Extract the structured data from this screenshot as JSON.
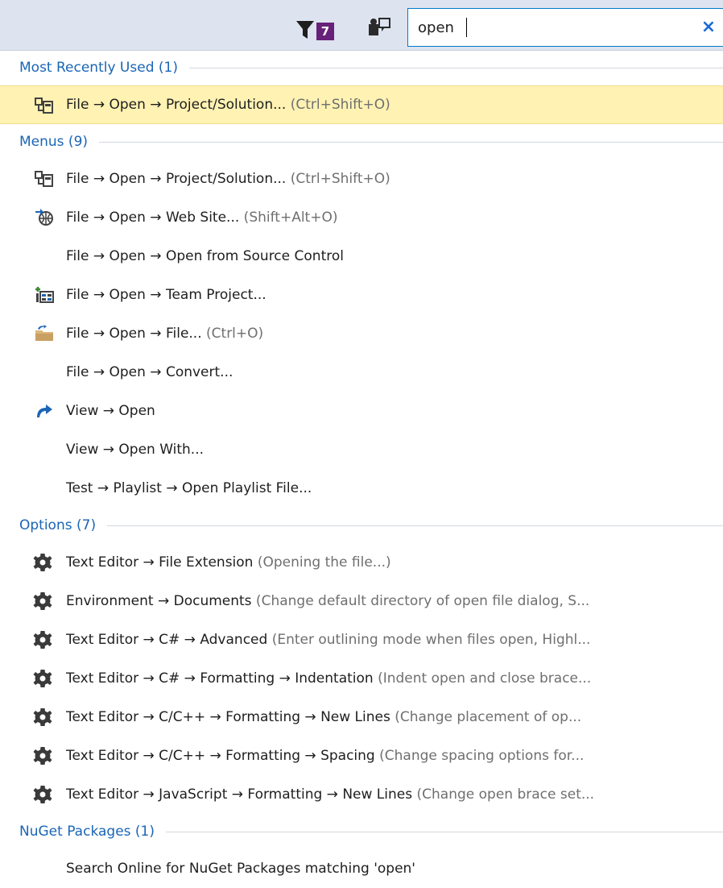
{
  "toolbar": {
    "filter_count": "7",
    "search_value": "open",
    "clear_glyph": "×"
  },
  "groups": [
    {
      "header": "Most Recently Used (1)",
      "items": [
        {
          "text": "File → Open → Project/Solution...",
          "hint": " (Ctrl+Shift+O)",
          "icon": "project-solution-icon",
          "selected": true
        }
      ]
    },
    {
      "header": "Menus (9)",
      "items": [
        {
          "text": "File → Open → Project/Solution...",
          "hint": " (Ctrl+Shift+O)",
          "icon": "project-solution-icon"
        },
        {
          "text": "File → Open → Web Site...",
          "hint": " (Shift+Alt+O)",
          "icon": "web-site-icon"
        },
        {
          "text": "File → Open → Open from Source Control",
          "hint": "",
          "icon": ""
        },
        {
          "text": "File → Open → Team Project...",
          "hint": "",
          "icon": "team-project-icon"
        },
        {
          "text": "File → Open → File...",
          "hint": " (Ctrl+O)",
          "icon": "open-folder-icon"
        },
        {
          "text": "File → Open → Convert...",
          "hint": "",
          "icon": ""
        },
        {
          "text": "View → Open",
          "hint": "",
          "icon": "open-arrow-icon"
        },
        {
          "text": "View → Open With...",
          "hint": "",
          "icon": ""
        },
        {
          "text": "Test → Playlist → Open Playlist File...",
          "hint": "",
          "icon": ""
        }
      ]
    },
    {
      "header": "Options (7)",
      "items": [
        {
          "text": "Text Editor → File Extension",
          "hint": " (Opening the file...)",
          "icon": "gear-icon"
        },
        {
          "text": "Environment → Documents",
          "hint": " (Change default directory of open file dialog, S...",
          "icon": "gear-icon"
        },
        {
          "text": "Text Editor → C# → Advanced",
          "hint": " (Enter outlining mode when files open, Highl...",
          "icon": "gear-icon"
        },
        {
          "text": "Text Editor → C# → Formatting → Indentation",
          "hint": " (Indent open and close brace...",
          "icon": "gear-icon"
        },
        {
          "text": "Text Editor → C/C++ → Formatting → New Lines",
          "hint": " (Change placement of op...",
          "icon": "gear-icon"
        },
        {
          "text": "Text Editor → C/C++ → Formatting → Spacing",
          "hint": " (Change spacing options for...",
          "icon": "gear-icon"
        },
        {
          "text": "Text Editor → JavaScript → Formatting → New Lines",
          "hint": " (Change open brace set...",
          "icon": "gear-icon"
        }
      ]
    },
    {
      "header": "NuGet Packages (1)",
      "items": [
        {
          "text": "Search Online for NuGet Packages matching 'open'",
          "hint": "",
          "icon": ""
        }
      ]
    }
  ]
}
